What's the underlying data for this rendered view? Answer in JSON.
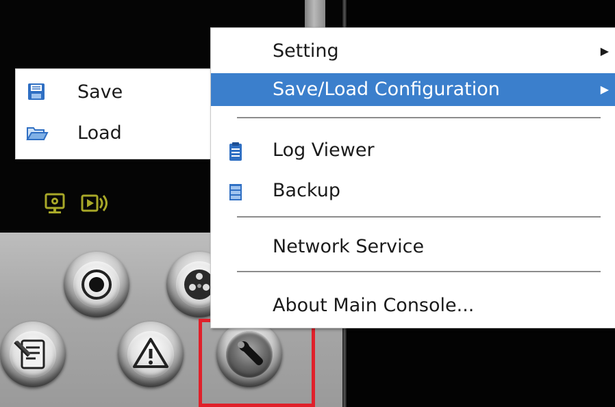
{
  "main_menu": {
    "items": [
      {
        "label": "Setting",
        "has_submenu": true,
        "arrow": "▶"
      },
      {
        "label": "Save/Load Configuration",
        "has_submenu": true,
        "arrow": "▶",
        "selected": true
      },
      {
        "label": "Log Viewer",
        "icon": "log-viewer-icon"
      },
      {
        "label": "Backup",
        "icon": "backup-icon"
      },
      {
        "label": "Network Service"
      },
      {
        "label": "About Main Console..."
      }
    ]
  },
  "submenu": {
    "items": [
      {
        "label": "Save",
        "icon": "floppy-disk-icon"
      },
      {
        "label": "Load",
        "icon": "folder-open-icon"
      }
    ]
  },
  "control_buttons": [
    {
      "name": "record",
      "icon": "record-icon"
    },
    {
      "name": "camera",
      "icon": "camera-icon"
    },
    {
      "name": "event-log",
      "icon": "event-log-icon"
    },
    {
      "name": "alarm",
      "icon": "alarm-warning-icon"
    },
    {
      "name": "settings",
      "icon": "wrench-icon",
      "highlighted": true
    }
  ],
  "colors": {
    "menu_selected": "#3b7fcc",
    "highlight_box": "#e0202a",
    "status_icon": "#a8a828"
  }
}
